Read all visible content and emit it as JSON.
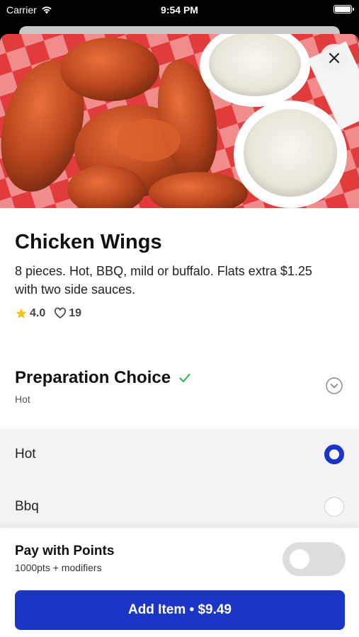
{
  "status_bar": {
    "carrier": "Carrier",
    "time": "9:54 PM"
  },
  "item": {
    "title": "Chicken Wings",
    "description": "8 pieces. Hot, BBQ, mild or buffalo. Flats extra $1.25 with two side sauces.",
    "rating": "4.0",
    "likes": "19"
  },
  "preparation": {
    "title": "Preparation Choice",
    "selected": "Hot",
    "options": [
      {
        "label": "Hot",
        "selected": true
      },
      {
        "label": "Bbq",
        "selected": false
      }
    ]
  },
  "points": {
    "title": "Pay with Points",
    "subtitle": "1000pts + modifiers",
    "enabled": false
  },
  "cta": {
    "label": "Add Item • $9.49"
  },
  "colors": {
    "accent": "#1b36c7",
    "check": "#2bb24c",
    "star": "#f5c518"
  },
  "icons": [
    "wifi-icon",
    "battery-icon",
    "close-icon",
    "star-icon",
    "heart-icon",
    "check-icon",
    "chevron-down-icon"
  ]
}
